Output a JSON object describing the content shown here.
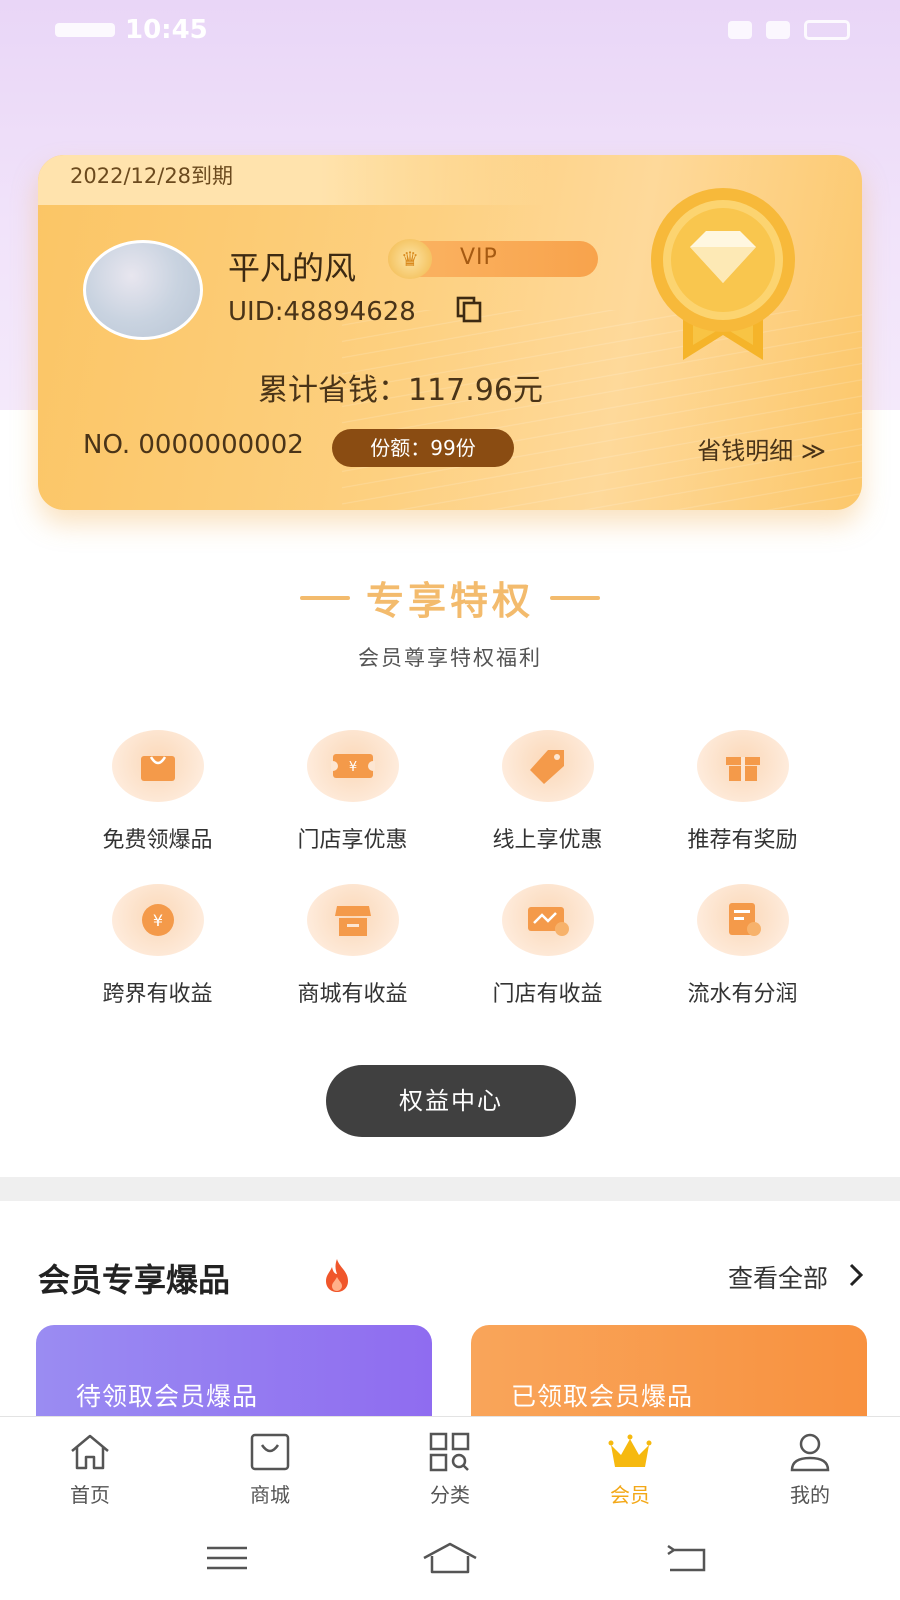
{
  "status_bar": {
    "time": "10:45"
  },
  "vip_card": {
    "expiry": "2022/12/28到期",
    "username": "平凡的风",
    "badge_text": "VIP",
    "uid": "UID:48894628",
    "saved": "累计省钱：117.96元",
    "number": "NO. 0000000002",
    "quota": "份额：99份",
    "detail_link": "省钱明细 ≫"
  },
  "privileges": {
    "title": "专享特权",
    "subtitle": "会员尊享特权福利",
    "items": [
      {
        "label": "免费领爆品",
        "icon": "shopping-bag-icon"
      },
      {
        "label": "门店享优惠",
        "icon": "coupon-icon"
      },
      {
        "label": "线上享优惠",
        "icon": "price-tag-icon"
      },
      {
        "label": "推荐有奖励",
        "icon": "gift-icon"
      },
      {
        "label": "跨界有收益",
        "icon": "yuan-coin-icon"
      },
      {
        "label": "商城有收益",
        "icon": "store-icon"
      },
      {
        "label": "门店有收益",
        "icon": "revenue-card-icon"
      },
      {
        "label": "流水有分润",
        "icon": "ledger-icon"
      }
    ],
    "center_button": "权益中心"
  },
  "featured": {
    "title": "会员专享爆品",
    "view_all": "查看全部",
    "cards": [
      {
        "label": "待领取会员爆品",
        "color": "#8f6cf0"
      },
      {
        "label": "已领取会员爆品",
        "color": "#f8913f"
      }
    ]
  },
  "tab_bar": {
    "items": [
      {
        "label": "首页",
        "icon": "home-icon"
      },
      {
        "label": "商城",
        "icon": "shop-bag-icon"
      },
      {
        "label": "分类",
        "icon": "category-grid-icon"
      },
      {
        "label": "会员",
        "icon": "crown-icon",
        "active": true
      },
      {
        "label": "我的",
        "icon": "user-icon"
      }
    ]
  },
  "colors": {
    "accent": "#f3a818",
    "card_gold": "#fdd080",
    "privilege_title": "#f3bb6d",
    "button_dark": "#404040"
  }
}
